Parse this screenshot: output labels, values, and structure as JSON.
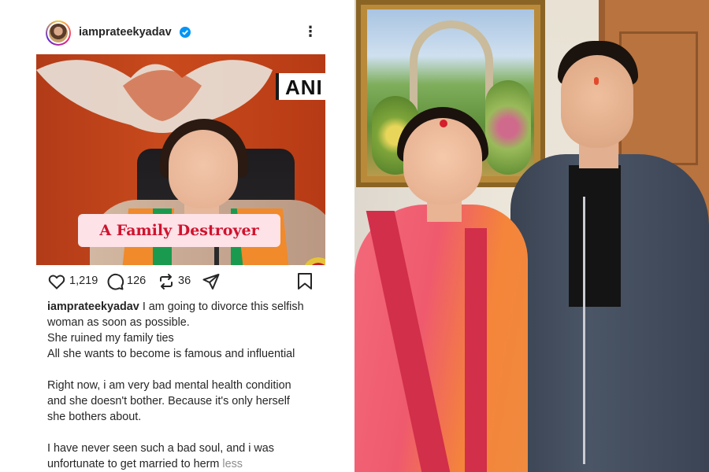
{
  "post": {
    "username": "iamprateekyadav",
    "media_tv_tag": "ANI",
    "media_caption": "A Family Destroyer",
    "likes": "1,219",
    "comments": "126",
    "reposts": "36",
    "caption_username": "iamprateekyadav",
    "caption_lines": [
      "I am going to divorce this selfish",
      "woman as soon as possible.",
      "She ruined my family ties",
      "All she wants to become is famous and influential"
    ],
    "caption_para2": [
      "Right now, i am very bad mental health condition",
      "and she doesn't bother. Because it's only herself",
      "she bothers about."
    ],
    "caption_para3": [
      "I have never seen such a bad soul, and i was",
      "unfortunate to get married to herm"
    ],
    "less_label": "less"
  },
  "icons": {
    "verified": "verified-badge-icon",
    "more": "more-options-icon",
    "like": "heart-icon",
    "comment": "comment-icon",
    "repost": "repost-icon",
    "share": "share-icon",
    "save": "bookmark-icon"
  },
  "colors": {
    "verified_blue": "#0095f6",
    "overlay_text_red": "#d0132e",
    "text": "#262626"
  }
}
